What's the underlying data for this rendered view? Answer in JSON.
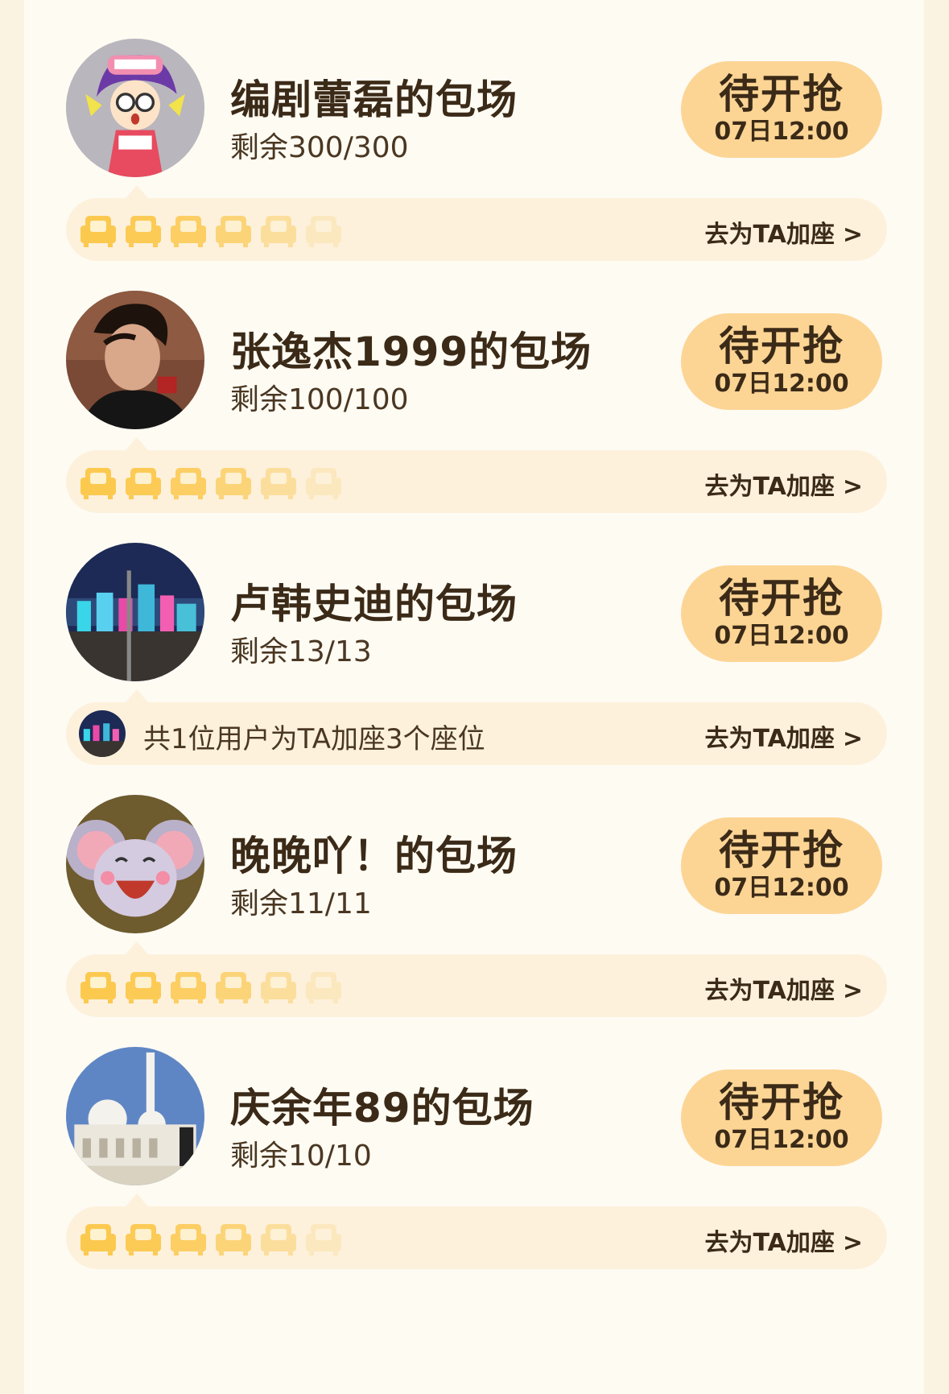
{
  "colors": {
    "page_bg": "#fbf3e2",
    "panel_bg": "#fefbf3",
    "button_bg": "#fcd595",
    "seat_bar_bg": "#fdf1dc",
    "seat_icon": "#fcc94f",
    "text_dark": "#3b2a17"
  },
  "cards": [
    {
      "title": "编剧蕾磊的包场",
      "remaining": "剩余300/300",
      "button_label": "待开抢",
      "button_time": "07日12:00",
      "avatar": "cartoon-girl-avatar",
      "seats_shown": 6,
      "add_seat_text": null,
      "add_seat_link": "去为TA加座",
      "arrow": ">"
    },
    {
      "title": "张逸杰1999的包场",
      "remaining": "剩余100/100",
      "button_label": "待开抢",
      "button_time": "07日12:00",
      "avatar": "man-portrait-avatar",
      "seats_shown": 6,
      "add_seat_text": null,
      "add_seat_link": "去为TA加座",
      "arrow": ">"
    },
    {
      "title": "卢韩史迪的包场",
      "remaining": "剩余13/13",
      "button_label": "待开抢",
      "button_time": "07日12:00",
      "avatar": "city-night-avatar",
      "seats_shown": 0,
      "add_seat_text": "共1位用户为TA加座3个座位",
      "add_seat_link": "去为TA加座",
      "arrow": ">"
    },
    {
      "title": "晚晚吖！的包场",
      "remaining": "剩余11/11",
      "button_label": "待开抢",
      "button_time": "07日12:00",
      "avatar": "cartoon-mouse-avatar",
      "seats_shown": 6,
      "add_seat_text": null,
      "add_seat_link": "去为TA加座",
      "arrow": ">"
    },
    {
      "title": "庆余年89的包场",
      "remaining": "剩余10/10",
      "button_label": "待开抢",
      "button_time": "07日12:00",
      "avatar": "mosque-avatar",
      "seats_shown": 6,
      "add_seat_text": null,
      "add_seat_link": "去为TA加座",
      "arrow": ">"
    }
  ]
}
